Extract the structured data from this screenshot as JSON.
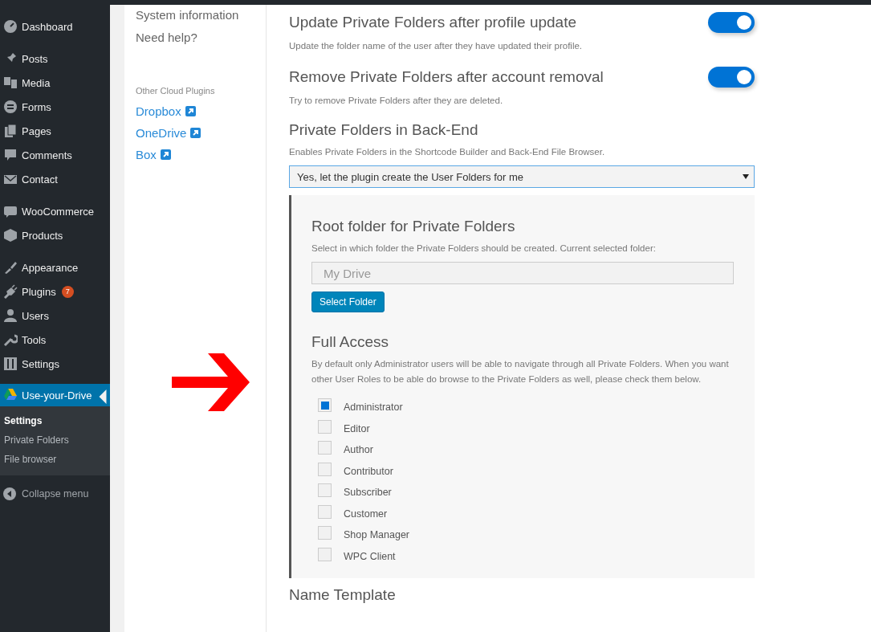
{
  "sidebar": {
    "groups": [
      [
        {
          "label": "Dashboard",
          "selected": false
        }
      ],
      [
        {
          "label": "Posts",
          "selected": false
        },
        {
          "label": "Media",
          "selected": false
        },
        {
          "label": "Forms",
          "selected": false
        },
        {
          "label": "Pages",
          "selected": false
        },
        {
          "label": "Comments",
          "selected": false
        },
        {
          "label": "Contact",
          "selected": false
        }
      ],
      [
        {
          "label": "WooCommerce",
          "selected": false
        },
        {
          "label": "Products",
          "selected": false
        }
      ],
      [
        {
          "label": "Appearance",
          "selected": false
        },
        {
          "label": "Plugins",
          "selected": false,
          "badge": "7"
        },
        {
          "label": "Users",
          "selected": false
        },
        {
          "label": "Tools",
          "selected": false
        },
        {
          "label": "Settings",
          "selected": false
        }
      ],
      [
        {
          "label": "Use-your-Drive",
          "selected": true,
          "children": [
            {
              "label": "Settings",
              "selected": true
            },
            {
              "label": "Private Folders",
              "selected": false
            },
            {
              "label": "File browser",
              "selected": false
            }
          ]
        }
      ]
    ],
    "collapse": "Collapse menu"
  },
  "nav": {
    "items": [
      "System information",
      "Need help?"
    ],
    "other_title": "Other Cloud Plugins",
    "links": [
      "Dropbox",
      "OneDrive",
      "Box"
    ]
  },
  "settings": [
    {
      "kind": "toggle",
      "title": "Update Private Folders after profile update",
      "description": "Update the folder name of the user after they have updated their profile.",
      "on": true
    },
    {
      "kind": "toggle",
      "title": "Remove Private Folders after account removal",
      "description": "Try to remove Private Folders after they are deleted.",
      "on": true
    },
    {
      "kind": "select",
      "title": "Private Folders in Back-End",
      "description": "Enables Private Folders in the Shortcode Builder and Back-End File Browser.",
      "value": "Yes, let the plugin create the User Folders for me"
    }
  ],
  "panel": {
    "root_title": "Root folder for Private Folders",
    "root_description": "Select in which folder the Private Folders should be created. Current selected folder:",
    "folder_value": "My Drive",
    "button": "Select Folder",
    "access_title": "Full Access",
    "access_description": "By default only Administrator users will be able to navigate through all Private Folders. When you want other User Roles to be able do browse to the Private Folders as well, please check them below.",
    "roles": [
      {
        "label": "Administrator",
        "checked": true
      },
      {
        "label": "Editor",
        "checked": false
      },
      {
        "label": "Author",
        "checked": false
      },
      {
        "label": "Contributor",
        "checked": false
      },
      {
        "label": "Subscriber",
        "checked": false
      },
      {
        "label": "Customer",
        "checked": false
      },
      {
        "label": "Shop Manager",
        "checked": false
      },
      {
        "label": "WPC Client",
        "checked": false
      }
    ]
  },
  "next_title": "Name Template"
}
